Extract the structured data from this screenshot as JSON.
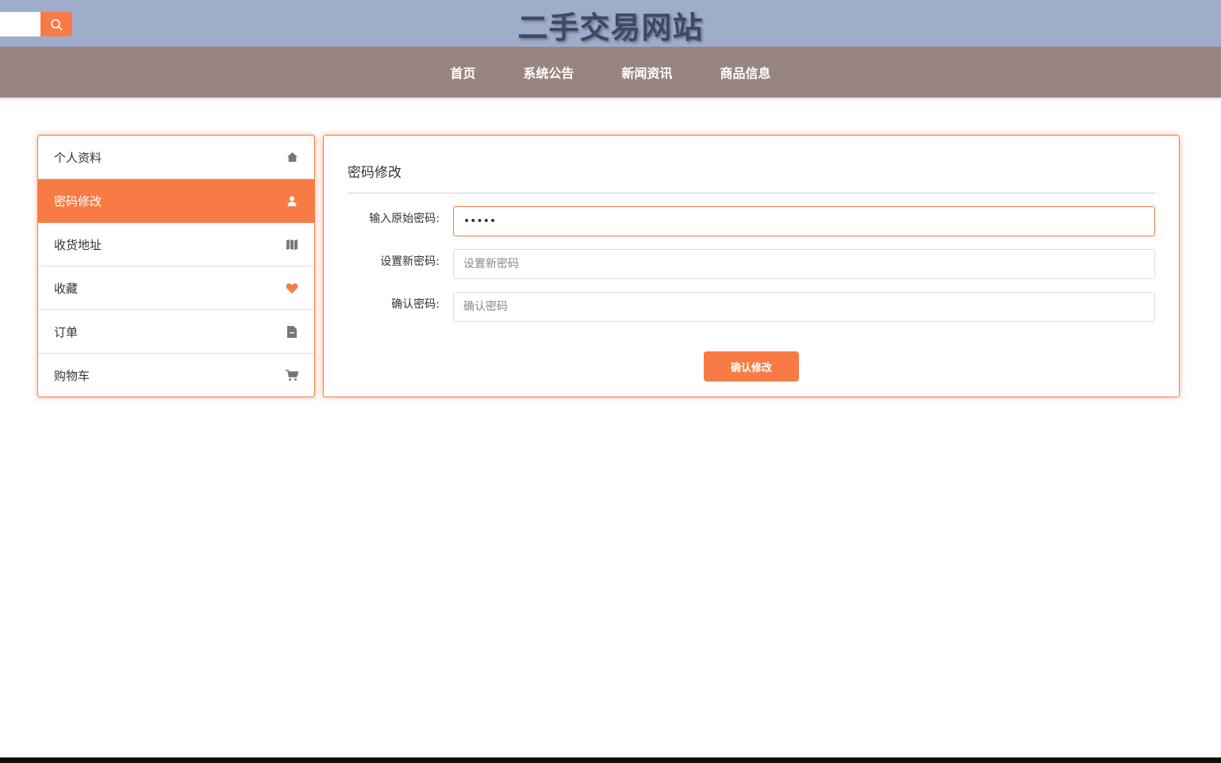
{
  "header": {
    "site_title": "二手交易网站",
    "search": {
      "value": "",
      "placeholder": ""
    }
  },
  "nav": {
    "items": [
      {
        "label": "首页"
      },
      {
        "label": "系统公告"
      },
      {
        "label": "新闻资讯"
      },
      {
        "label": "商品信息"
      }
    ]
  },
  "sidebar": {
    "active_index": 1,
    "items": [
      {
        "label": "个人资料",
        "icon": "home-icon"
      },
      {
        "label": "密码修改",
        "icon": "user-icon"
      },
      {
        "label": "收货地址",
        "icon": "map-icon"
      },
      {
        "label": "收藏",
        "icon": "heart-icon"
      },
      {
        "label": "订单",
        "icon": "file-icon"
      },
      {
        "label": "购物车",
        "icon": "cart-icon"
      }
    ]
  },
  "form": {
    "title": "密码修改",
    "old_password": {
      "label": "输入原始密码:",
      "value": "12345",
      "placeholder": ""
    },
    "new_password": {
      "label": "设置新密码:",
      "value": "",
      "placeholder": "设置新密码"
    },
    "confirm_password": {
      "label": "确认密码:",
      "value": "",
      "placeholder": "确认密码"
    },
    "submit_label": "确认修改"
  },
  "colors": {
    "accent": "#f87b45",
    "header_bg": "#9eadc9",
    "nav_bg": "#998580",
    "heart": "#f87b45",
    "icon_gray": "#777777"
  }
}
